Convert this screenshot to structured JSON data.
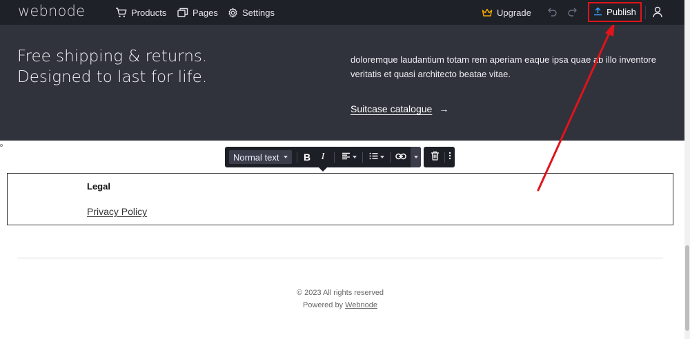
{
  "topbar": {
    "logo": "webnode",
    "nav": [
      {
        "label": "Products",
        "icon": "cart-icon"
      },
      {
        "label": "Pages",
        "icon": "pages-icon"
      },
      {
        "label": "Settings",
        "icon": "gear-icon"
      }
    ],
    "upgrade": "Upgrade",
    "publish": "Publish",
    "colors": {
      "bar": "#1f2129",
      "upgrade_crown": "#f2a900",
      "publish_icon": "#3aa0ff",
      "highlight": "#e0141a"
    }
  },
  "hero": {
    "line1": "Free shipping & returns.",
    "line2": "Designed to last for life.",
    "paragraph": "doloremque laudantium totam rem aperiam eaque ipsa quae ab illo inventore veritatis et quasi architecto beatae vitae.",
    "link": "Suitcase catalogue",
    "link_arrow": "→",
    "colors": {
      "background": "#30323c"
    }
  },
  "toolbar": {
    "text_style": "Normal text",
    "bold": "B",
    "italic": "I",
    "icons": [
      "align-left-icon",
      "list-icon",
      "link-icon",
      "trash-icon",
      "more-vertical-icon"
    ]
  },
  "legal": {
    "heading": "Legal",
    "link": "Privacy Policy"
  },
  "footer": {
    "copyright": "© 2023 All rights reserved",
    "powered_prefix": "Powered by ",
    "powered_link": "Webnode"
  }
}
